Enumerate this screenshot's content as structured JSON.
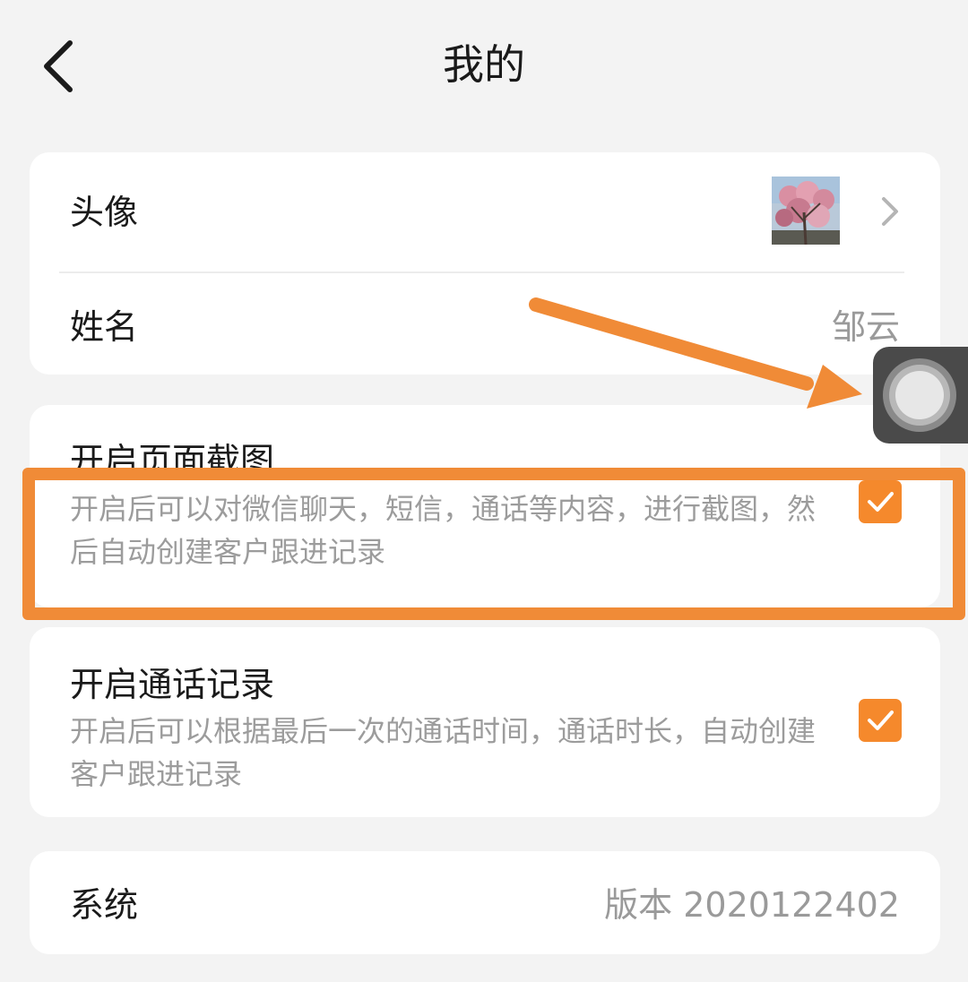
{
  "header": {
    "title": "我的"
  },
  "profile": {
    "avatar_label": "头像",
    "name_label": "姓名",
    "name_value": "邹云"
  },
  "settings": [
    {
      "title": "开启页面截图",
      "description": "开启后可以对微信聊天，短信，通话等内容，进行截图，然后自动创建客户跟进记录",
      "checked": true
    },
    {
      "title": "开启通话记录",
      "description": "开启后可以根据最后一次的通话时间，通话时长，自动创建客户跟进记录",
      "checked": true
    }
  ],
  "system": {
    "label": "系统",
    "version": "版本 2020122402"
  },
  "icons": {
    "back": "back-arrow-icon",
    "chevron": "chevron-right-icon",
    "check": "checkmark-icon",
    "assistive": "assistive-touch-icon"
  },
  "colors": {
    "accent": "#f5892c",
    "annotation": "#f08b37",
    "background": "#f3f3f3",
    "card": "#ffffff",
    "secondary_text": "#9c9c9c"
  }
}
